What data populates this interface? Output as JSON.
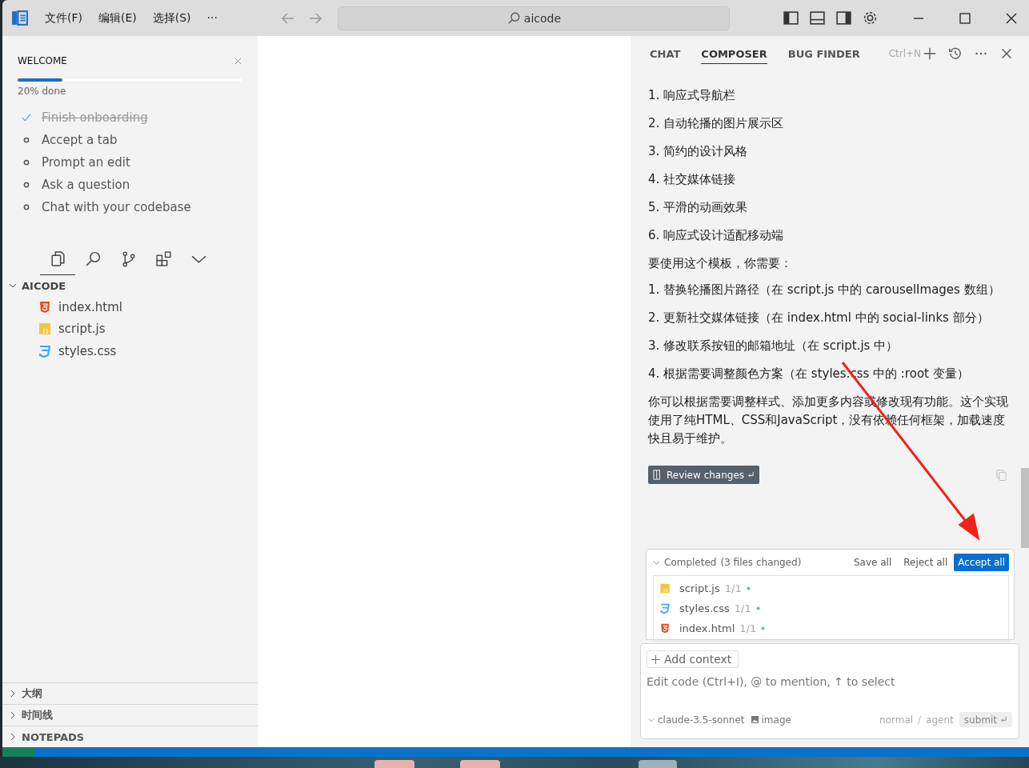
{
  "titlebar": {
    "menus": [
      {
        "label": "文件(F)"
      },
      {
        "label": "编辑(E)"
      },
      {
        "label": "选择(S)"
      },
      {
        "label": "···"
      }
    ],
    "search": {
      "value": "aicode"
    }
  },
  "welcome": {
    "title": "WELCOME",
    "level": 0.2,
    "progress_text": "20% done",
    "steps": [
      {
        "label": "Finish onboarding",
        "done": true
      },
      {
        "label": "Accept a tab",
        "done": false
      },
      {
        "label": "Prompt an edit",
        "done": false
      },
      {
        "label": "Ask a question",
        "done": false
      },
      {
        "label": "Chat with your codebase",
        "done": false
      }
    ]
  },
  "view_tabs": [
    {
      "kind": "files",
      "selected": true
    },
    {
      "kind": "search",
      "selected": false
    },
    {
      "kind": "branch",
      "selected": false
    },
    {
      "kind": "extensions",
      "selected": false
    },
    {
      "kind": "more",
      "selected": false
    }
  ],
  "explorer": {
    "title": "AICODE",
    "expanded": true,
    "files": [
      {
        "name": "index.html",
        "kind": "html"
      },
      {
        "name": "script.js",
        "kind": "js"
      },
      {
        "name": "styles.css",
        "kind": "css"
      }
    ]
  },
  "bottom_sections": [
    {
      "label": "大纲",
      "expanded": false
    },
    {
      "label": "时间线",
      "expanded": false
    },
    {
      "label": "NOTEPADS",
      "expanded": false
    }
  ],
  "panel": {
    "tabs": [
      {
        "label": "CHAT",
        "selected": false
      },
      {
        "label": "COMPOSER",
        "selected": true
      },
      {
        "label": "BUG FINDER",
        "selected": false
      }
    ],
    "shortcut": "Ctrl+N"
  },
  "message": {
    "paragraphs": [
      {
        "text": "1. 响应式导航栏"
      },
      {
        "text": "2. 自动轮播的图片展示区"
      },
      {
        "text": "3. 简约的设计风格"
      },
      {
        "text": "4. 社交媒体链接"
      },
      {
        "text": "5. 平滑的动画效果"
      },
      {
        "text": "6. 响应式设计适配移动端"
      },
      {
        "text": "要使用这个模板，你需要："
      },
      {
        "text": "1. 替换轮播图片路径（在 script.js 中的 carouselImages 数组）"
      },
      {
        "text": "2. 更新社交媒体链接（在 index.html 中的 social-links 部分）"
      },
      {
        "text": "3. 修改联系按钮的邮箱地址（在 script.js 中）"
      },
      {
        "text": "4. 根据需要调整颜色方案（在 styles.css 中的 :root 变量）"
      },
      {
        "text": "你可以根据需要调整样式、添加更多内容或修改现有功能。这个实现使用了纯HTML、CSS和JavaScript，没有依赖任何框架，加载速度快且易于维护。"
      }
    ],
    "review_button": "Review changes"
  },
  "changes": {
    "status": "Completed",
    "count": "(3 files changed)",
    "expanded": true,
    "actions": [
      {
        "label": "Save all",
        "kind": "plain"
      },
      {
        "label": "Reject all",
        "kind": "plain"
      },
      {
        "label": "Accept all",
        "kind": "primary"
      }
    ],
    "files": [
      {
        "name": "script.js",
        "kind": "js",
        "count": "1/1"
      },
      {
        "name": "styles.css",
        "kind": "css",
        "count": "1/1"
      },
      {
        "name": "index.html",
        "kind": "html",
        "count": "1/1"
      }
    ]
  },
  "composer": {
    "add_context": "Add context",
    "placeholder": "Edit code (Ctrl+I), @ to mention, ↑ to select",
    "model": "claude-3.5-sonnet",
    "image": "image",
    "mode": "normal",
    "separator": "/",
    "agent": "agent",
    "submit": "submit"
  }
}
